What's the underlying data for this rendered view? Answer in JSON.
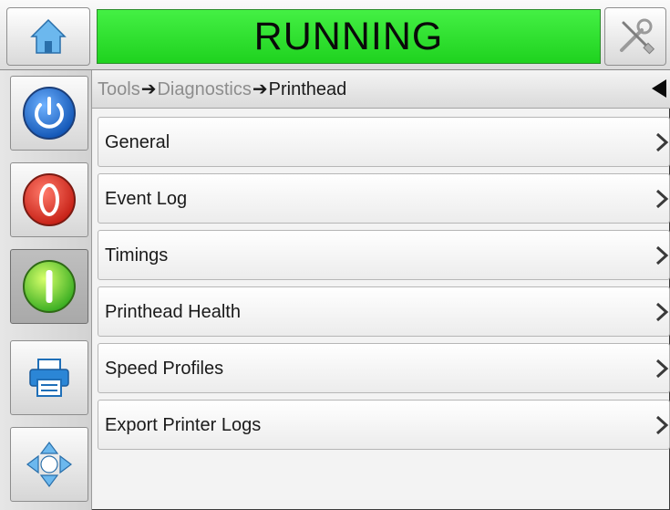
{
  "status": {
    "text": "RUNNING",
    "color": "#2ee02e"
  },
  "breadcrumb": {
    "items": [
      "Tools",
      "Diagnostics"
    ],
    "separator": "➔",
    "current": "Printhead"
  },
  "menu": {
    "items": [
      {
        "label": "General"
      },
      {
        "label": "Event Log"
      },
      {
        "label": "Timings"
      },
      {
        "label": "Printhead Health"
      },
      {
        "label": "Speed Profiles"
      },
      {
        "label": "Export Printer Logs"
      }
    ]
  },
  "icons": {
    "home": "home-icon",
    "tools": "tools-icon",
    "power": "power-icon",
    "stop": "stop-icon",
    "start": "start-icon",
    "print": "printer-icon",
    "navigate": "navigate-icon",
    "back": "back-arrow-icon",
    "chevron": "chevron-right-icon"
  }
}
